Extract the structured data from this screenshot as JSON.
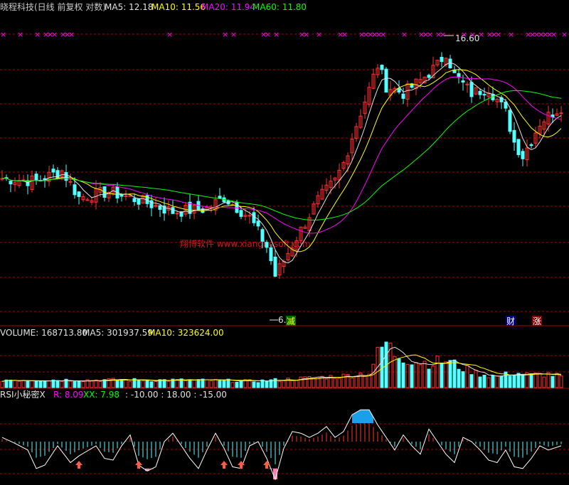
{
  "header": {
    "title": "晓程科技(日线 前复权 对数)",
    "ma5_label": "MA5: 12.18",
    "ma10_label": "MA10: 11.56",
    "ma20_label": "MA20: 11.94",
    "ma60_label": "MA60: 11.80"
  },
  "watermark": "翔博软件 www.xiangbosoft.com",
  "colors": {
    "background": "#000000",
    "up_candle": "#ff3232",
    "down_candle": "#54ffff",
    "ma5": "#e0e0e0",
    "ma10": "#ffff00",
    "ma20": "#ff00ff",
    "ma60": "#00ff00",
    "grid": "#b00000",
    "marker": "#ff00ff",
    "rsi_fill_high": "#1aa0e8",
    "rsi_fill_low": "#ff80b0",
    "arrow": "#ff5a3c"
  },
  "price_panel": {
    "high_label": "16.60",
    "low_label": "6.",
    "badges": [
      "减",
      "财",
      "涨"
    ],
    "marker_glyph": "×"
  },
  "volume_panel": {
    "volume_label": "VOLUME: 168713.80",
    "ma5_label": "MA5: 301937.59",
    "ma10_label": "MA10: 323624.00"
  },
  "rsi_panel": {
    "name": "RSI小秘密X",
    "r_label": "R: 8.09",
    "xx_label": "XX: 7.98",
    "levels_label": ": -10.00 : 18.00 : -15.00"
  },
  "chart_data": {
    "type": "candlestick",
    "scale": "log",
    "y_range": [
      5.5,
      18.5
    ],
    "bar_count": 132,
    "anchors": [
      [
        0,
        9.7
      ],
      [
        8,
        9.6
      ],
      [
        14,
        10.0
      ],
      [
        18,
        9.0
      ],
      [
        25,
        9.2
      ],
      [
        32,
        8.9
      ],
      [
        40,
        8.5
      ],
      [
        48,
        8.6
      ],
      [
        52,
        9.0
      ],
      [
        58,
        8.3
      ],
      [
        62,
        7.4
      ],
      [
        64,
        6.6
      ],
      [
        66,
        7.0
      ],
      [
        70,
        7.9
      ],
      [
        74,
        8.9
      ],
      [
        78,
        9.6
      ],
      [
        80,
        10.3
      ],
      [
        83,
        12.0
      ],
      [
        86,
        13.8
      ],
      [
        88,
        15.2
      ],
      [
        90,
        14.0
      ],
      [
        94,
        13.6
      ],
      [
        98,
        14.3
      ],
      [
        102,
        15.2
      ],
      [
        104,
        16.0
      ],
      [
        106,
        14.6
      ],
      [
        110,
        13.6
      ],
      [
        114,
        13.9
      ],
      [
        118,
        12.6
      ],
      [
        120,
        11.2
      ],
      [
        122,
        10.6
      ],
      [
        124,
        11.3
      ],
      [
        126,
        12.1
      ],
      [
        129,
        12.6
      ],
      [
        131,
        12.9
      ]
    ],
    "highlights": [
      {
        "index": 105,
        "value": 16.6,
        "label": "16.60"
      },
      {
        "index": 63,
        "value": 6.0,
        "label": "6."
      }
    ],
    "markers_bar_indices": [
      0,
      4,
      8,
      10,
      11,
      12,
      14,
      15,
      16,
      39,
      52,
      54,
      61,
      62,
      64,
      70,
      71,
      74,
      79,
      80,
      84,
      85,
      86,
      87,
      88,
      89,
      94,
      98,
      99,
      100,
      102,
      103,
      108,
      110,
      112,
      114,
      115,
      116,
      119,
      123,
      124,
      125,
      126,
      127,
      128,
      129,
      132
    ],
    "volume": {
      "anchors": [
        [
          0,
          120000
        ],
        [
          40,
          115000
        ],
        [
          60,
          100000
        ],
        [
          70,
          140000
        ],
        [
          80,
          180000
        ],
        [
          86,
          230000
        ],
        [
          88,
          520000
        ],
        [
          90,
          700000
        ],
        [
          92,
          520000
        ],
        [
          96,
          420000
        ],
        [
          100,
          380000
        ],
        [
          104,
          420000
        ],
        [
          108,
          300000
        ],
        [
          112,
          210000
        ],
        [
          116,
          170000
        ],
        [
          120,
          230000
        ],
        [
          124,
          190000
        ],
        [
          128,
          210000
        ],
        [
          131,
          168714
        ]
      ],
      "ylim": [
        0,
        760000
      ]
    },
    "rsi": {
      "anchors": [
        [
          0,
          55
        ],
        [
          3,
          48
        ],
        [
          6,
          40
        ],
        [
          8,
          18
        ],
        [
          10,
          22
        ],
        [
          13,
          45
        ],
        [
          16,
          25
        ],
        [
          18,
          33
        ],
        [
          22,
          45
        ],
        [
          24,
          30
        ],
        [
          26,
          28
        ],
        [
          28,
          45
        ],
        [
          30,
          58
        ],
        [
          32,
          22
        ],
        [
          34,
          15
        ],
        [
          36,
          20
        ],
        [
          38,
          50
        ],
        [
          40,
          60
        ],
        [
          42,
          45
        ],
        [
          44,
          30
        ],
        [
          46,
          18
        ],
        [
          48,
          40
        ],
        [
          50,
          60
        ],
        [
          52,
          42
        ],
        [
          54,
          20
        ],
        [
          56,
          18
        ],
        [
          58,
          45
        ],
        [
          60,
          50
        ],
        [
          62,
          30
        ],
        [
          64,
          5
        ],
        [
          66,
          42
        ],
        [
          68,
          62
        ],
        [
          70,
          60
        ],
        [
          72,
          55
        ],
        [
          74,
          60
        ],
        [
          76,
          68
        ],
        [
          78,
          55
        ],
        [
          80,
          62
        ],
        [
          82,
          82
        ],
        [
          84,
          88
        ],
        [
          86,
          88
        ],
        [
          88,
          70
        ],
        [
          90,
          55
        ],
        [
          92,
          40
        ],
        [
          94,
          58
        ],
        [
          96,
          45
        ],
        [
          98,
          35
        ],
        [
          100,
          65
        ],
        [
          102,
          50
        ],
        [
          104,
          35
        ],
        [
          106,
          25
        ],
        [
          108,
          55
        ],
        [
          110,
          50
        ],
        [
          112,
          40
        ],
        [
          114,
          28
        ],
        [
          116,
          25
        ],
        [
          118,
          40
        ],
        [
          120,
          20
        ],
        [
          122,
          18
        ],
        [
          124,
          30
        ],
        [
          126,
          45
        ],
        [
          128,
          40
        ],
        [
          131,
          45
        ]
      ],
      "upper_level": 72,
      "lower_level": 18,
      "ylim": [
        0,
        100
      ],
      "arrow_bar_indices": [
        18,
        32,
        52,
        56,
        62
      ]
    }
  }
}
